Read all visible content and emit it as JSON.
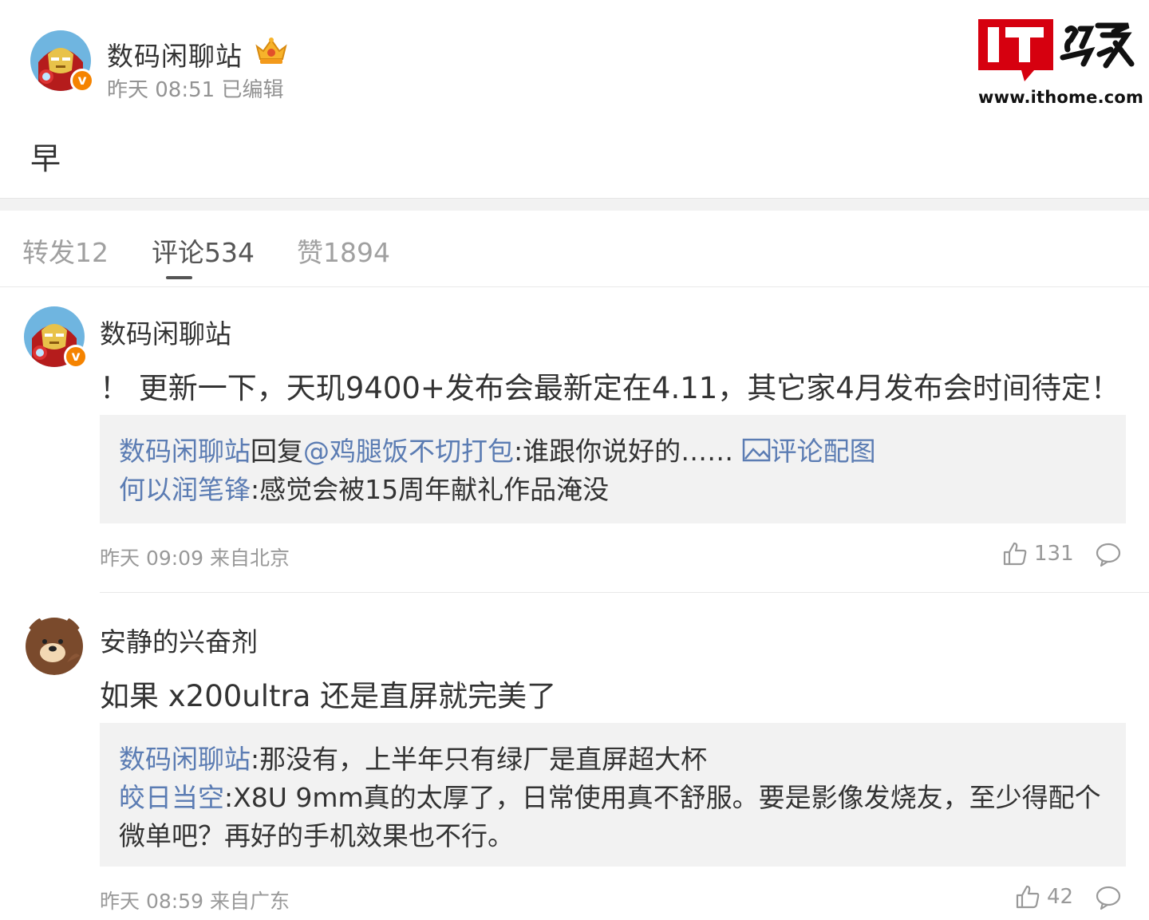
{
  "post": {
    "author": "数码闲聊站",
    "time": "昨天 08:51 已编辑",
    "text": "早"
  },
  "logo": {
    "brand_it": "IT",
    "brand_home": "之家",
    "url": "www.ithome.com"
  },
  "tabs": [
    {
      "label": "转发12"
    },
    {
      "label": "评论534"
    },
    {
      "label": "赞1894"
    }
  ],
  "comments": [
    {
      "name": "数码闲聊站",
      "body": "！ 更新一下，天玑9400+发布会最新定在4.11，其它家4月发布会时间待定！",
      "replies": [
        {
          "user": "数码闲聊站",
          "text": "回复",
          "target": "@鸡腿饭不切打包",
          "rest": ":谁跟你说好的…… ",
          "pic_label": "评论配图"
        },
        {
          "user": "何以润笔锋",
          "text": ":感觉会被15周年献礼作品淹没"
        }
      ],
      "meta": "昨天 09:09 来自北京",
      "likes": "131"
    },
    {
      "name": "安静的兴奋剂",
      "body": "如果 x200ultra 还是直屏就完美了",
      "replies": [
        {
          "user": "数码闲聊站",
          "text": ":那没有，上半年只有绿厂是直屏超大杯"
        },
        {
          "user": "皎日当空",
          "text": ":X8U 9mm真的太厚了，日常使用真不舒服。要是影像发烧友，至少得配个",
          "text2": "微单吧？再好的手机效果也不行。"
        }
      ],
      "meta": "昨天 08:59 来自广东",
      "likes": "42"
    }
  ],
  "colors": {
    "link": "#5b7cb3",
    "vbadge": "#f58300",
    "logo_red": "#d6000f"
  }
}
